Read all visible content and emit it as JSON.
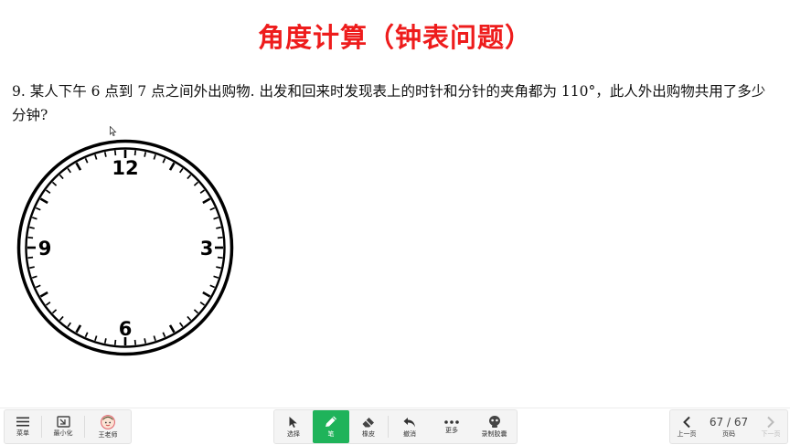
{
  "slide": {
    "title": "角度计算（钟表问题）",
    "problem": "9. 某人下午 6 点到 7 点之间外出购物. 出发和回来时发现表上的时针和分针的夹角都为 110°，此人外出购物共用了多少分钟?",
    "clock": {
      "numbers": {
        "n12": "12",
        "n3": "3",
        "n6": "6",
        "n9": "9"
      }
    }
  },
  "toolbar": {
    "left": {
      "menu": "菜单",
      "minimize": "最小化",
      "teacher": "王老师"
    },
    "tools": {
      "select": "选择",
      "pen": "笔",
      "eraser": "橡皮",
      "undo": "撤消",
      "more": "更多",
      "record": "录制胶囊"
    },
    "nav": {
      "prev": "上一页",
      "page": "67 / 67",
      "page_label": "页码",
      "next": "下一页"
    }
  },
  "colors": {
    "title": "#ee1c1c",
    "active_tool": "#1fb35a"
  },
  "icons": [
    "menu-icon",
    "minimize-icon",
    "avatar-icon",
    "cursor-icon",
    "pen-icon",
    "eraser-icon",
    "undo-icon",
    "more-icon",
    "record-icon",
    "chevron-left-icon",
    "chevron-right-icon"
  ]
}
